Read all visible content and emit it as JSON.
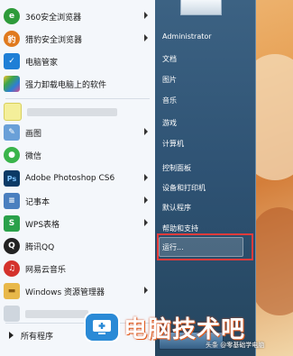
{
  "programs": [
    {
      "label": "360安全浏览器",
      "icon": "360-browser-icon",
      "color": "#2e9b3a",
      "glyph": "e",
      "submenu": true
    },
    {
      "label": "猎豹安全浏览器",
      "icon": "cheetah-browser-icon",
      "color": "#e07a1f",
      "glyph": "豹",
      "submenu": true
    },
    {
      "label": "电脑管家",
      "icon": "pc-manager-shield-icon",
      "color": "#1f7fd6",
      "glyph": "✓",
      "submenu": false
    },
    {
      "label": "强力卸载电脑上的软件",
      "icon": "uninstall-tool-icon",
      "color": "#3da54a",
      "glyph": "◆",
      "submenu": false
    },
    {
      "label": "画图",
      "icon": "paint-icon",
      "color": "#6aa0d8",
      "glyph": "✎",
      "submenu": true
    },
    {
      "label": "微信",
      "icon": "wechat-icon",
      "color": "#3ab44a",
      "glyph": "●",
      "submenu": false
    },
    {
      "label": "Adobe Photoshop CS6",
      "icon": "photoshop-icon",
      "color": "#0c3a66",
      "glyph": "Ps",
      "submenu": true
    },
    {
      "label": "记事本",
      "icon": "notepad-icon",
      "color": "#4a7fbf",
      "glyph": "≡",
      "submenu": true
    },
    {
      "label": "WPS表格",
      "icon": "wps-spreadsheet-icon",
      "color": "#2aa14a",
      "glyph": "S",
      "submenu": true
    },
    {
      "label": "腾讯QQ",
      "icon": "qq-penguin-icon",
      "color": "#222222",
      "glyph": "Q",
      "submenu": false
    },
    {
      "label": "网易云音乐",
      "icon": "netease-music-icon",
      "color": "#d4322c",
      "glyph": "♫",
      "submenu": false
    },
    {
      "label": "Windows 资源管理器",
      "icon": "explorer-folder-icon",
      "color": "#e8b84a",
      "glyph": "▬",
      "submenu": true
    }
  ],
  "all_programs": "所有程序",
  "user": {
    "name": "Administrator"
  },
  "right_items": [
    {
      "label": "文档"
    },
    {
      "label": "图片"
    },
    {
      "label": "音乐"
    },
    {
      "label": "游戏"
    },
    {
      "label": "计算机"
    },
    {
      "label": "控制面板"
    },
    {
      "label": "设备和打印机"
    },
    {
      "label": "默认程序"
    },
    {
      "label": "帮助和支持"
    },
    {
      "label": "运行..."
    }
  ],
  "watermark": {
    "text": "电脑技术吧",
    "caption": "头条 @零基础学电脑"
  }
}
